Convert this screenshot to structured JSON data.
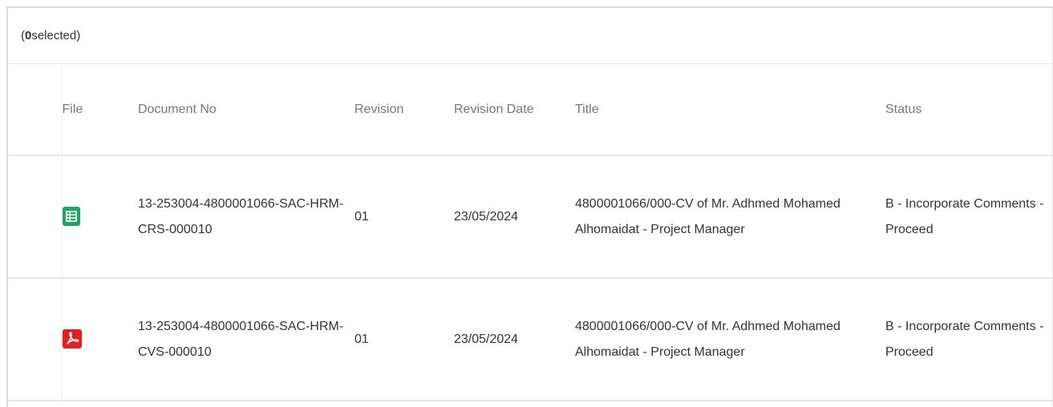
{
  "selection": {
    "open_paren": "(",
    "count": "0",
    "suffix": " selected)"
  },
  "columns": {
    "file": "File",
    "document_no": "Document No",
    "revision": "Revision",
    "revision_date": "Revision Date",
    "title": "Title",
    "status": "Status"
  },
  "rows": [
    {
      "file_icon": "spreadsheet-icon",
      "document_no": "13-253004-4800001066-SAC-HRM-CRS-000010",
      "revision": "01",
      "revision_date": "23/05/2024",
      "title": "4800001066/000-CV of Mr. Adhmed Mohamed Alhomaidat - Project Manager",
      "status": "B - Incorporate Comments - Proceed"
    },
    {
      "file_icon": "pdf-icon",
      "document_no": "13-253004-4800001066-SAC-HRM-CVS-000010",
      "revision": "01",
      "revision_date": "23/05/2024",
      "title": "4800001066/000-CV of Mr. Adhmed Mohamed Alhomaidat - Project Manager",
      "status": "B - Incorporate Comments - Proceed"
    }
  ],
  "colors": {
    "spreadsheet_icon": "#21a366",
    "pdf_icon": "#e02020",
    "header_text": "#777777",
    "border": "#e8e8e8"
  }
}
